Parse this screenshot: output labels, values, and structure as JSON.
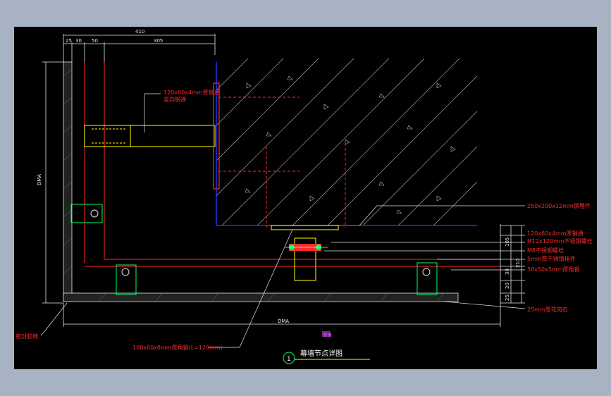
{
  "drawing": {
    "title": "幕墙节点详图",
    "callout_number": "1",
    "scale_label": "剖 面"
  },
  "dimensions": {
    "top_total": "410",
    "top_segments": [
      "25",
      "30",
      "50",
      "305"
    ],
    "left_vertical": "DMA",
    "bottom_width": "DMA",
    "right_segments": [
      "105",
      "210",
      "30",
      "20",
      "25"
    ]
  },
  "annotations": {
    "pipe_top": "120x60x4mm厚钢通",
    "pipe_top_2": "竖向钢通",
    "embed_plate": "250x200x12mm钢埋件",
    "pipe_right": "120x60x4mm厚钢通",
    "bolt": "M12x120mm不锈钢螺栓",
    "bolt_m8": "M8不锈钢螺栓",
    "bracket": "5mm厚不锈钢挂件",
    "angle": "50x50x5mm厚角钢",
    "stone": "25mm厚花岗石",
    "angle_bottom": "100x60x8mm厚角钢(L=120mm)",
    "corner_note": "密封胶缝"
  },
  "colors": {
    "background": "#000000",
    "frame": "#a7b2c3",
    "red": "#ff2a2a",
    "yellow": "#ffff00",
    "white": "#e6e6e6",
    "blue": "#2233ff",
    "green": "#00ff66"
  }
}
